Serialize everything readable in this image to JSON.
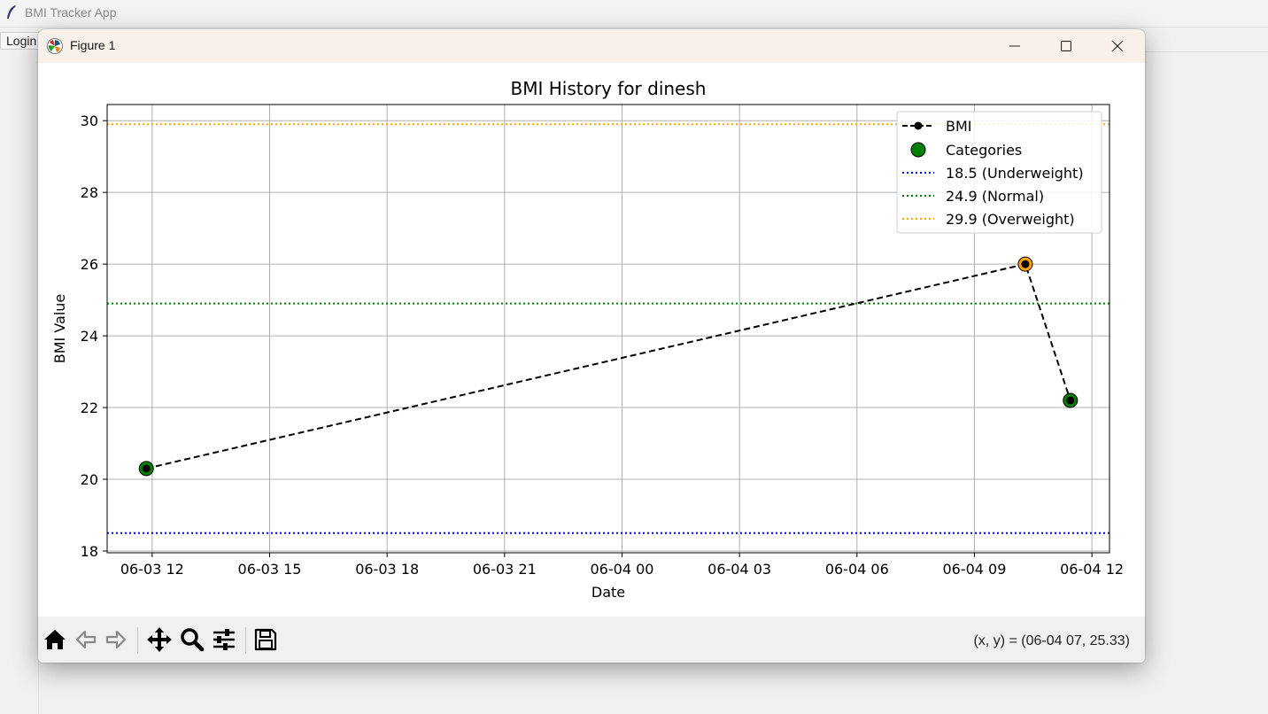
{
  "background_app": {
    "title": "BMI Tracker App",
    "menu_login": "Login"
  },
  "window": {
    "title": "Figure 1",
    "controls": {
      "minimize": "minimize-icon",
      "maximize": "maximize-icon",
      "close": "close-icon"
    }
  },
  "chart_data": {
    "type": "line",
    "title": "BMI History for dinesh",
    "xlabel": "Date",
    "ylabel": "BMI Value",
    "x_ticks": [
      "06-03 12",
      "06-03 15",
      "06-03 18",
      "06-03 21",
      "06-04 00",
      "06-04 03",
      "06-04 06",
      "06-04 09",
      "06-04 12"
    ],
    "x_tick_hours": [
      12,
      15,
      18,
      21,
      24,
      27,
      30,
      33,
      36
    ],
    "y_ticks": [
      18,
      20,
      22,
      24,
      26,
      28,
      30
    ],
    "xlim_hours": [
      10.85,
      36.45
    ],
    "ylim": [
      17.95,
      30.45
    ],
    "grid": true,
    "legend_position": "top-right",
    "series": [
      {
        "name": "BMI",
        "style": "dashed-with-markers",
        "color": "#000000",
        "x_hours": [
          11.85,
          34.3,
          35.45
        ],
        "x_labels": [
          "06-03 11:51",
          "06-04 10:18",
          "06-04 11:27"
        ],
        "values": [
          20.3,
          26.0,
          22.2
        ]
      }
    ],
    "categories_markers": {
      "name": "Categories",
      "colors": [
        "#008000",
        "#ffa500",
        "#008000"
      ]
    },
    "reference_lines": [
      {
        "label": "18.5 (Underweight)",
        "value": 18.5,
        "color": "#0000ff"
      },
      {
        "label": "24.9 (Normal)",
        "value": 24.9,
        "color": "#008000"
      },
      {
        "label": "29.9 (Overweight)",
        "value": 29.9,
        "color": "#ffa500"
      }
    ]
  },
  "toolbar": {
    "buttons": [
      "home-icon",
      "back-icon",
      "forward-icon",
      "pan-icon",
      "zoom-icon",
      "configure-icon",
      "save-icon"
    ],
    "coordinates": "(x, y) = (06-04 07, 25.33)"
  }
}
